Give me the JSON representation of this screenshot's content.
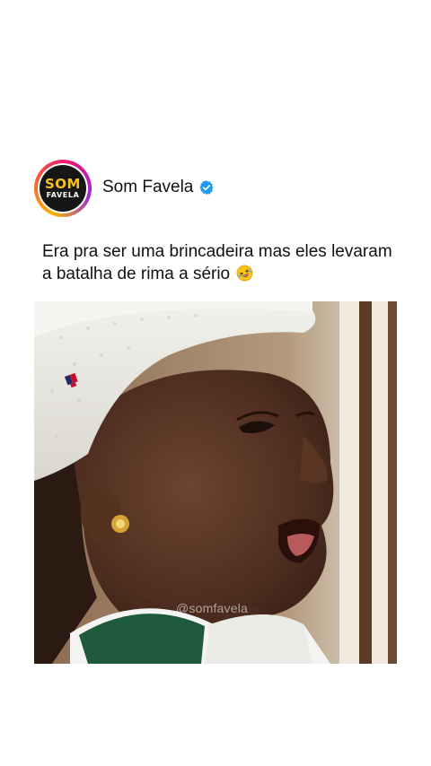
{
  "account": {
    "name": "Som Favela",
    "verified": true,
    "logo_top": "SOM",
    "logo_bottom": "FAVELA"
  },
  "post": {
    "caption": "Era pra ser uma brincadeira mas eles levaram a batalha de rima a sério",
    "caption_emoji": "rolling-on-floor-laughing-emoji",
    "watermark": "@somfavela"
  },
  "colors": {
    "verified_blue": "#1d9bf0",
    "logo_yellow": "#f7c21e",
    "logo_bg": "#161616"
  }
}
